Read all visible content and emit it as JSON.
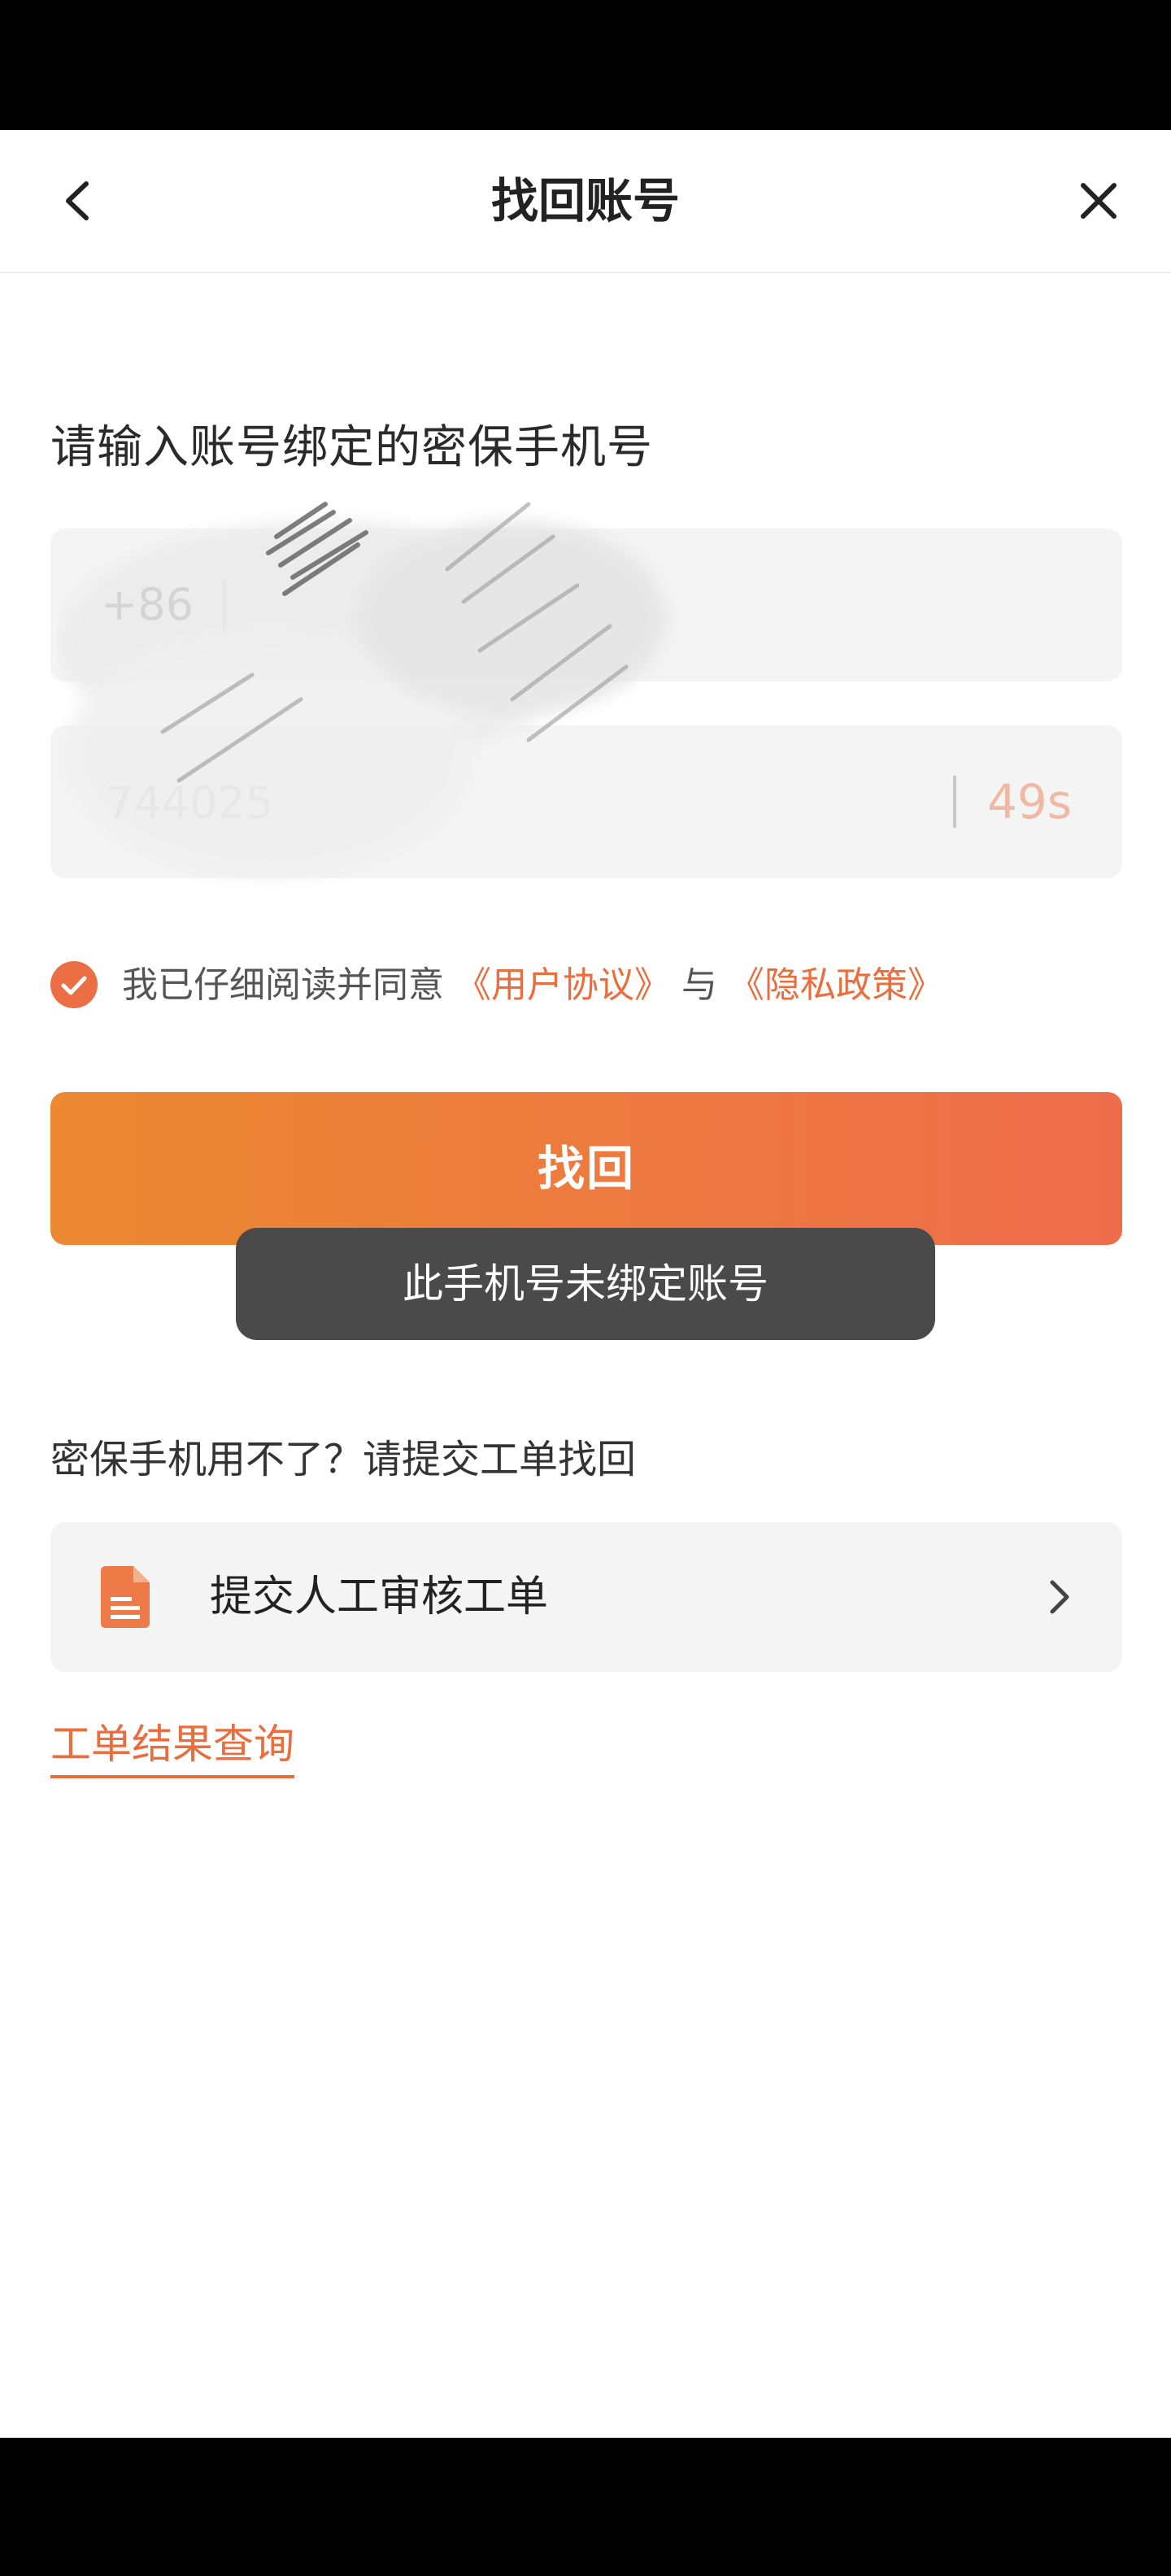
{
  "nav": {
    "title": "找回账号",
    "back_icon": "chevron-left-icon",
    "close_icon": "close-icon"
  },
  "form": {
    "prompt": "请输入账号绑定的密保手机号",
    "country_code": "+86",
    "phone_value": "",
    "code_value": "744025",
    "countdown": "49s"
  },
  "agreement": {
    "checked": true,
    "prefix": "我已仔细阅读并同意",
    "user_agreement": "《用户协议》",
    "conjunction": "与",
    "privacy_policy": "《隐私政策》"
  },
  "submit": {
    "label": "找回"
  },
  "toast": {
    "text": "此手机号未绑定账号"
  },
  "help": {
    "text": "密保手机用不了？请提交工单找回",
    "ticket_label": "提交人工审核工单",
    "ticket_icon": "document-icon",
    "chevron_icon": "chevron-right-icon",
    "result_link": "工单结果查询"
  },
  "colors": {
    "accent": "#ea6d3d",
    "button_start": "#ec8932",
    "button_end": "#ee6c4b",
    "toast_bg": "#4a4a4a",
    "countdown": "#f0b9a4"
  }
}
